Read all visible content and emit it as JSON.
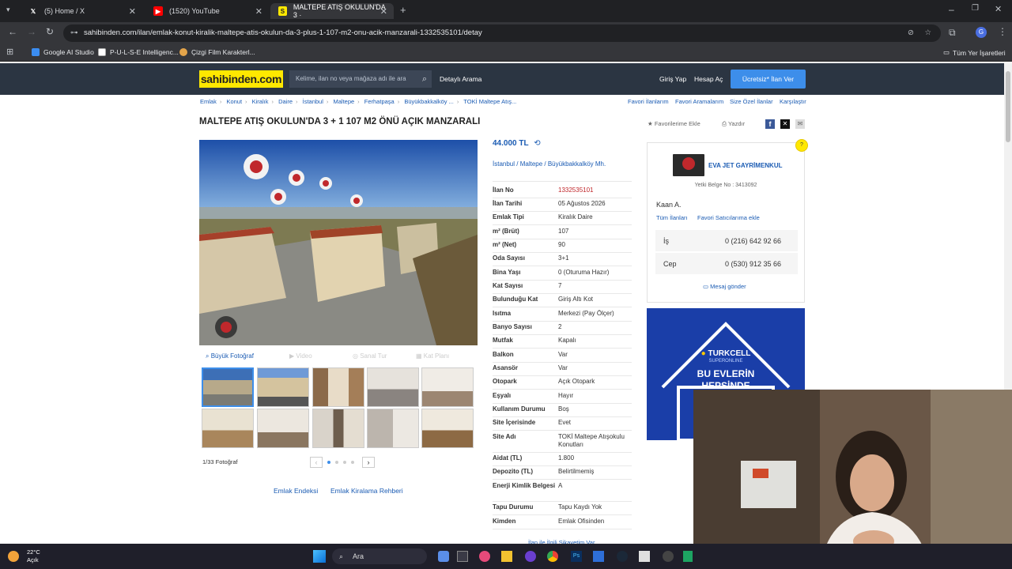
{
  "browser": {
    "tabs": [
      {
        "label": "(5) Home / X",
        "icon": "x-logo-icon"
      },
      {
        "label": "(1520) YouTube",
        "icon": "youtube-icon"
      },
      {
        "label": "MALTEPE ATIŞ OKULUN'DA 3 ·",
        "icon": "sahibinden-icon"
      }
    ],
    "url": "sahibinden.com/ilan/emlak-konut-kiralik-maltepe-atis-okulun-da-3-plus-1-107-m2-onu-acik-manzarali-1332535101/detay",
    "bookmarks": [
      "Google AI Studio",
      "P-U-L-S-E Intelligenc...",
      "Çizgi Film Karakterl..."
    ],
    "all_bookmarks": "Tüm Yer İşaretleri"
  },
  "header": {
    "logo": "sahibinden.com",
    "search_placeholder": "Kelime, ilan no veya mağaza adı ile ara",
    "detailed_search": "Detaylı Arama",
    "login": "Giriş Yap",
    "register": "Hesap Aç",
    "post_ad": "Ücretsiz* İlan Ver"
  },
  "breadcrumbs": [
    "Emlak",
    "Konut",
    "Kiralık",
    "Daire",
    "İstanbul",
    "Maltepe",
    "Ferhatpaşa",
    "Büyükbakkalköy ...",
    "TOKİ Maltepe Atış..."
  ],
  "right_links": [
    "Favori İlanlarım",
    "Favori Aramalarım",
    "Size Özel İlanlar",
    "Karşılaştır"
  ],
  "listing": {
    "title": "MALTEPE ATIŞ OKULUN'DA 3 + 1 107 M2 ÖNÜ AÇIK MANZARALI",
    "add_favorite": "Favorilerime Ekle",
    "print": "Yazdır",
    "price": "44.000 TL",
    "location": [
      "İstanbul",
      "Maltepe",
      "Büyükbakkalköy Mh."
    ],
    "photo_tabs": {
      "big_photo": "Büyük Fotoğraf",
      "video": "Video",
      "virtual_tour": "Sanal Tur",
      "floor_plan": "Kat Planı"
    },
    "photo_count": "1/33 Fotoğraf",
    "links": [
      "Emlak Endeksi",
      "Emlak Kiralama Rehberi"
    ],
    "details": [
      {
        "label": "İlan No",
        "value": "1332535101"
      },
      {
        "label": "İlan Tarihi",
        "value": "05 Ağustos 2026"
      },
      {
        "label": "Emlak Tipi",
        "value": "Kiralık Daire"
      },
      {
        "label": "m² (Brüt)",
        "value": "107"
      },
      {
        "label": "m² (Net)",
        "value": "90"
      },
      {
        "label": "Oda Sayısı",
        "value": "3+1"
      },
      {
        "label": "Bina Yaşı",
        "value": "0 (Oturuma Hazır)"
      },
      {
        "label": "Kat Sayısı",
        "value": "7"
      },
      {
        "label": "Bulunduğu Kat",
        "value": "Giriş Altı Kot"
      },
      {
        "label": "Isıtma",
        "value": "Merkezi (Pay Ölçer)"
      },
      {
        "label": "Banyo Sayısı",
        "value": "2"
      },
      {
        "label": "Mutfak",
        "value": "Kapalı"
      },
      {
        "label": "Balkon",
        "value": "Var"
      },
      {
        "label": "Asansör",
        "value": "Var"
      },
      {
        "label": "Otopark",
        "value": "Açık Otopark"
      },
      {
        "label": "Eşyalı",
        "value": "Hayır"
      },
      {
        "label": "Kullanım Durumu",
        "value": "Boş"
      },
      {
        "label": "Site İçerisinde",
        "value": "Evet"
      },
      {
        "label": "Site Adı",
        "value": "TOKİ Maltepe Atışokulu Konutları"
      },
      {
        "label": "Aidat (TL)",
        "value": "1.800"
      },
      {
        "label": "Depozito (TL)",
        "value": "Belirtilmemiş"
      },
      {
        "label": "Enerji Kimlik Belgesi",
        "value": "A"
      },
      {
        "label": "Tapu Durumu",
        "value": "Tapu Kaydı Yok"
      },
      {
        "label": "Kimden",
        "value": "Emlak Ofisinden"
      }
    ],
    "complaint": "İlan ile İlgili Şikayetim Var"
  },
  "seller": {
    "name": "EVA JET GAYRİMENKUL",
    "license": "Yetki Belge No : 3413092",
    "agent": "Kaan A.",
    "all_listings": "Tüm İlanları",
    "add_fav_seller": "Favori Satıcılarıma ekle",
    "phones": [
      {
        "label": "İş",
        "number": "0 (216) 642 92 66"
      },
      {
        "label": "Cep",
        "number": "0 (530) 912 35 66"
      }
    ],
    "message": "Mesaj gönder"
  },
  "ad": {
    "brand": "TURKCELL",
    "sub": "SUPERONLINE",
    "line1": "BU EVLERİN",
    "line2": "HEPSİNDE"
  },
  "taskbar": {
    "weather_temp": "22°C",
    "weather_desc": "Açık",
    "search": "Ara"
  }
}
